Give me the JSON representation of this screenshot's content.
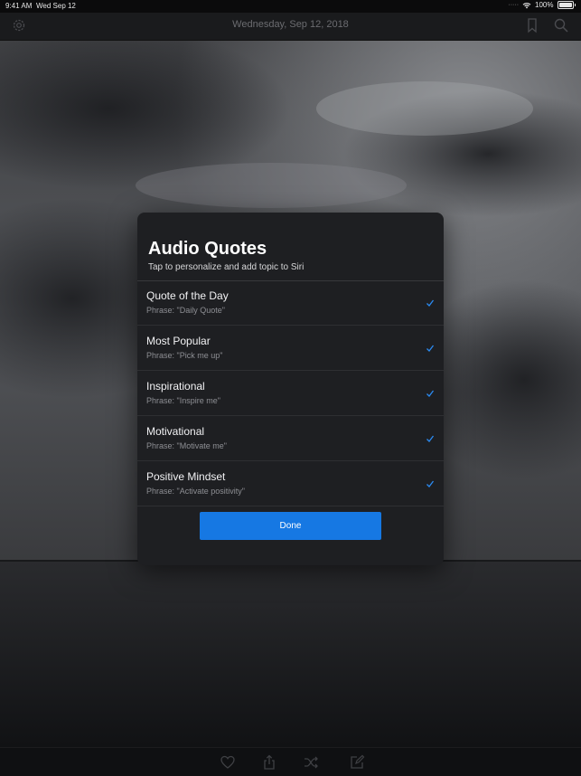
{
  "status_bar": {
    "time": "9:41 AM",
    "date": "Wed Sep 12",
    "battery": "100%",
    "icons": [
      "signal-icon",
      "wifi-icon",
      "battery-icon"
    ]
  },
  "nav_bar": {
    "title": "Wednesday, Sep 12, 2018",
    "icons": [
      "gear-icon",
      "bookmark-icon",
      "search-icon"
    ]
  },
  "modal": {
    "title": "Audio Quotes",
    "subtitle": "Tap to personalize and add topic to Siri",
    "options": [
      {
        "name": "Quote of the Day",
        "phrase": "Phrase: \"Daily Quote\"",
        "checked": true
      },
      {
        "name": "Most Popular",
        "phrase": "Phrase: \"Pick me up\"",
        "checked": true
      },
      {
        "name": "Inspirational",
        "phrase": "Phrase: \"Inspire me\"",
        "checked": true
      },
      {
        "name": "Motivational",
        "phrase": "Phrase: \"Motivate me\"",
        "checked": true
      },
      {
        "name": "Positive Mindset",
        "phrase": "Phrase: \"Activate positivity\"",
        "checked": true
      }
    ],
    "done_label": "Done"
  },
  "tab_bar": {
    "icons": [
      "heart-icon",
      "share-icon",
      "shuffle-icon",
      "compose-icon"
    ]
  },
  "colors": {
    "accent": "#1678e3",
    "check": "#2b8bf2",
    "modal_bg": "#1e1f22",
    "nav_bg": "#1a1b1d"
  }
}
